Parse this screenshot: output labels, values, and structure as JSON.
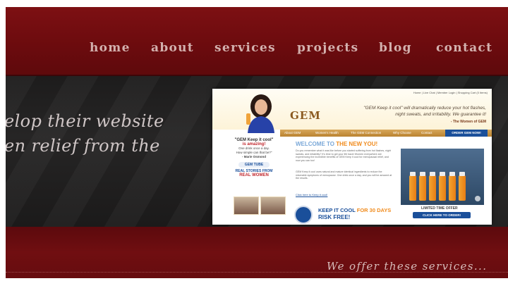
{
  "nav": {
    "items": [
      "home",
      "about",
      "services",
      "projects",
      "blog",
      "contact"
    ]
  },
  "hero": {
    "tagline_line1": "elop their website",
    "tagline_line2": "en relief from the"
  },
  "screenshot": {
    "top_links": "Home | Live Chat | Member Login | Shopping Cart (0 items)",
    "logo": "GEM",
    "quote_line1": "\"GEM Keep it cool\" will dramatically reduce your hot flashes,",
    "quote_line2": "night sweats, and irritability. We guarantee it!",
    "quote_signature": "- The Women of GEM",
    "menu": [
      "About GEM",
      "Women's Health",
      "The GEM Connection",
      "Why Choose",
      "Contact"
    ],
    "order_button": "ORDER GEM NOW!",
    "sidebar": {
      "head1": "\"GEM Keep it cool\"",
      "head2": "is amazing!",
      "small1": "One drink once a day.",
      "small2": "How simple can that be?\"",
      "signature": "- Marie Osmond",
      "pill": "GEM TUBE",
      "stories1": "REAL STORIES FROM",
      "stories2": "REAL WOMEN"
    },
    "welcome_prefix": "WELCOME TO ",
    "welcome_accent": "THE NEW YOU!",
    "body_text_1": "Do you remember what it was like before you started suffering from hot flashes, night sweats, and irritability? It's time to get your life back! Women everywhere are experiencing the incredible benefits of GEM Keep it cool for menopausal relief, and now you can too!",
    "body_text_2": "GEM Keep it cool uses natural and mature identical ingredients to reduce the miserable symptoms of menopause. One drink once a day, and you will be amazed at the results.",
    "link": "Click here to Keep it cool!",
    "keep_cool_prefix": "KEEP IT COOL ",
    "keep_cool_accent": "FOR 30 DAYS",
    "risk_free": "RISK FREE!",
    "limited": "LIMITED TIME OFFER",
    "click_button": "CLICK HERE TO ORDER!"
  },
  "footer": {
    "offer": "We offer these services..."
  },
  "colors": {
    "header_red": "#7d1013",
    "band_dark": "#1d1c1c",
    "nav_text": "#d3b1ae",
    "gem_blue": "#1a4f9a",
    "gem_orange": "#f08b1d"
  }
}
